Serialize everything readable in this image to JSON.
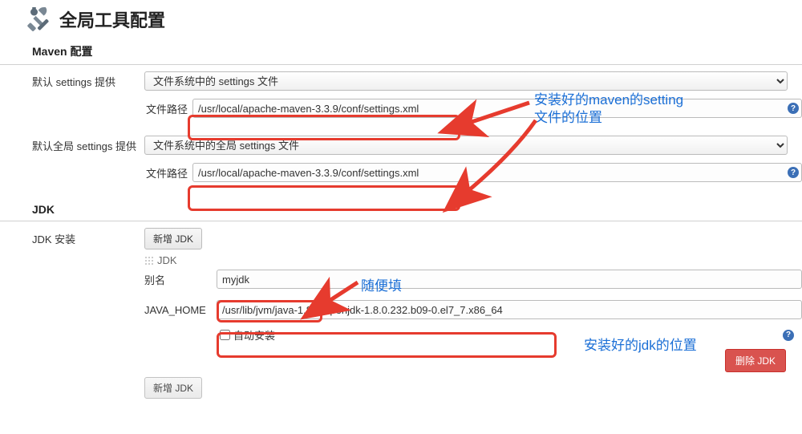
{
  "page": {
    "title": "全局工具配置"
  },
  "maven": {
    "section_title": "Maven 配置",
    "default_settings_label": "默认 settings 提供",
    "default_settings_select": "文件系统中的 settings 文件",
    "file_path_label": "文件路径",
    "file_path_value_1": "/usr/local/apache-maven-3.3.9/conf/settings.xml",
    "global_settings_label": "默认全局 settings 提供",
    "global_settings_select": "文件系统中的全局 settings 文件",
    "file_path_value_2": "/usr/local/apache-maven-3.3.9/conf/settings.xml"
  },
  "jdk": {
    "section_title": "JDK",
    "install_label": "JDK 安装",
    "add_button": "新增 JDK",
    "block_title": "JDK",
    "alias_label": "别名",
    "alias_value": "myjdk",
    "java_home_label": "JAVA_HOME",
    "java_home_value": "/usr/lib/jvm/java-1.8.0-openjdk-1.8.0.232.b09-0.el7_7.x86_64",
    "auto_install_label": "自动安装",
    "delete_button": "删除 JDK",
    "add_button_2": "新增 JDK"
  },
  "annotations": {
    "maven_note_1": "安装好的maven的setting",
    "maven_note_2": "文件的位置",
    "jdk_alias_note": "随便填",
    "jdk_home_note": "安装好的jdk的位置"
  }
}
